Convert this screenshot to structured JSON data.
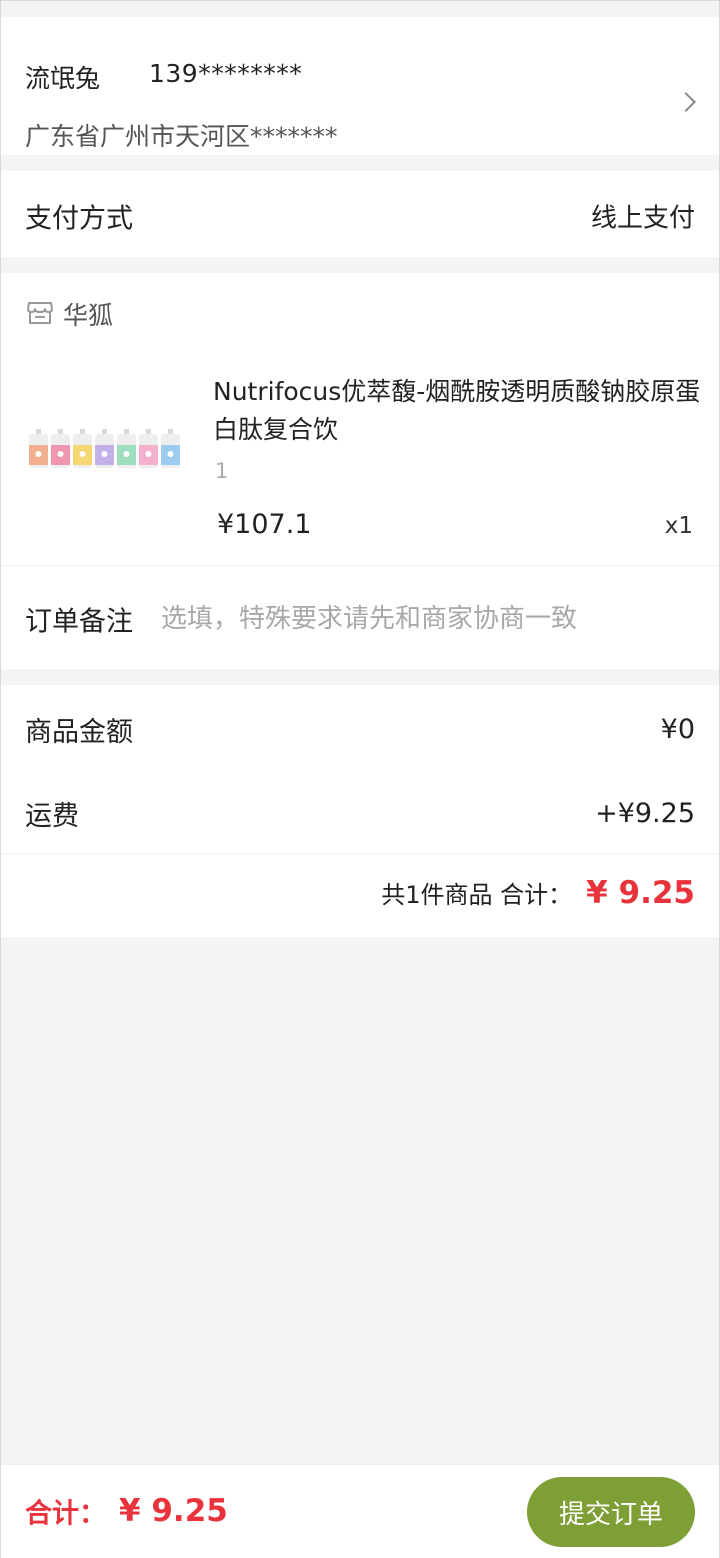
{
  "address": {
    "name": "流氓兔",
    "phone": "139********",
    "detail": "广东省广州市天河区*******"
  },
  "payment": {
    "label": "支付方式",
    "value": "线上支付"
  },
  "store": {
    "icon": "store-icon",
    "name": "华狐",
    "product": {
      "title": "Nutrifocus优萃馥-烟酰胺透明质酸钠胶原蛋白肽复合饮",
      "spec": "1",
      "price": "¥107.1",
      "quantity": "x1",
      "image_colors": [
        "#f2a37b",
        "#ee87a5",
        "#f7d35d",
        "#b8a6e6",
        "#8fd9b5",
        "#f4a6c8",
        "#8dc6ee"
      ]
    },
    "remark": {
      "label": "订单备注",
      "placeholder": "选填，特殊要求请先和商家协商一致"
    }
  },
  "summary": {
    "goods_amount_label": "商品金额",
    "goods_amount_value": "¥0",
    "shipping_label": "运费",
    "shipping_value": "+¥9.25",
    "total_text": "共1件商品 合计：",
    "total_amount": "¥ 9.25"
  },
  "bottom_bar": {
    "total_label": "合计：",
    "total_amount": "¥ 9.25",
    "submit_label": "提交订单"
  },
  "colors": {
    "accent_red": "#e8333c",
    "submit_green": "#7e9f35"
  }
}
